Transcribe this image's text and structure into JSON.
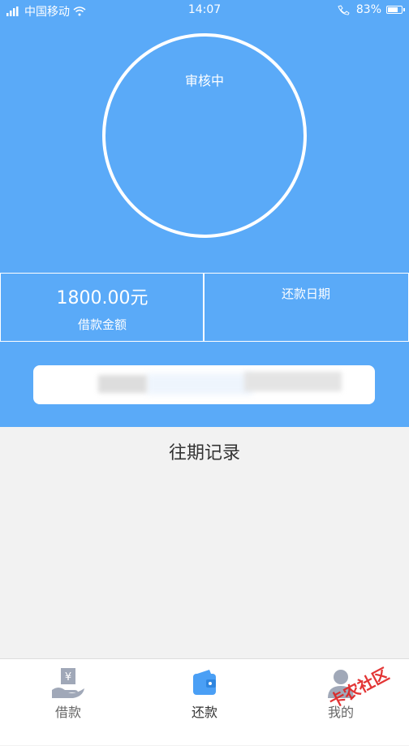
{
  "status_bar": {
    "carrier": "中国移动",
    "time": "14:07",
    "battery": "83%",
    "battery_level": 0.83
  },
  "loan_status": {
    "circle_text": "审核中"
  },
  "info": {
    "amount_value": "1800.00元",
    "amount_label": "借款金额",
    "date_label": "还款日期"
  },
  "history": {
    "title": "往期记录"
  },
  "tabbar": {
    "items": [
      {
        "label": "借款",
        "icon": "loan-icon"
      },
      {
        "label": "还款",
        "icon": "wallet-icon"
      },
      {
        "label": "我的",
        "icon": "user-icon"
      }
    ],
    "active_index": 1
  },
  "watermark": {
    "text": "卡农社区"
  },
  "colors": {
    "primary": "#5aaaf8",
    "background": "#f2f2f2",
    "tab_active": "#4a9ff5",
    "tab_inactive": "#a0a8b8"
  }
}
